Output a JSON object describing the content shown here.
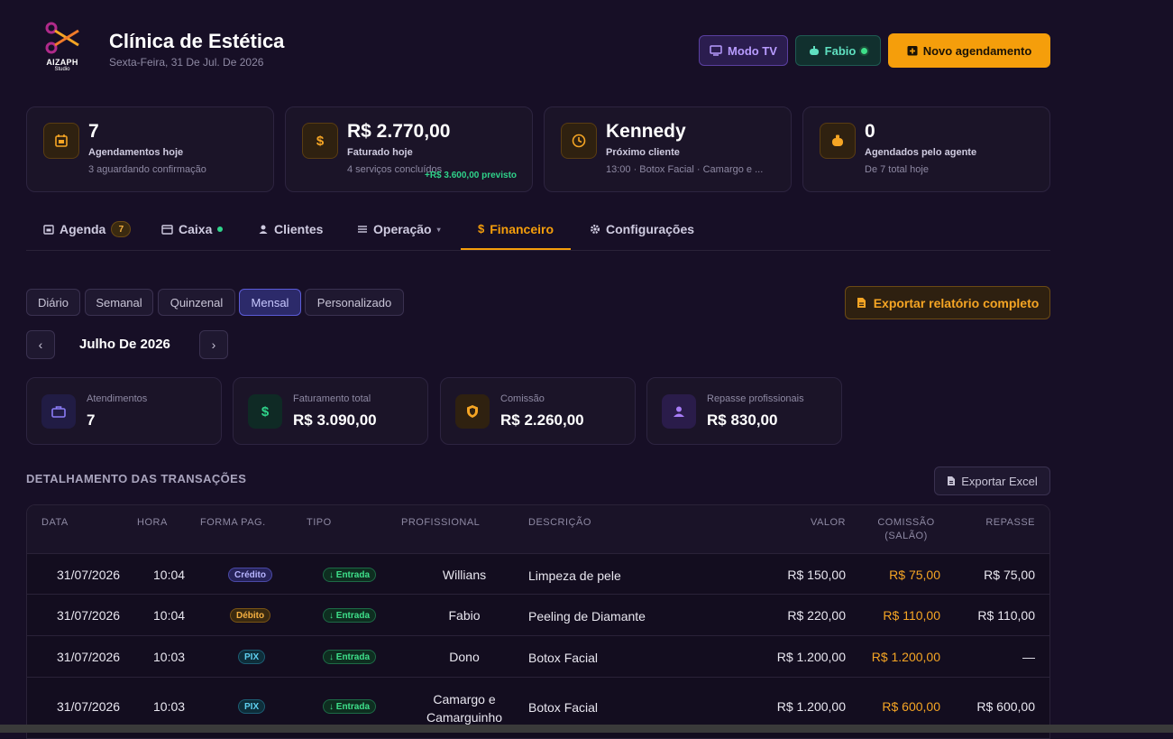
{
  "header": {
    "logo": {
      "brand": "AIZAPH",
      "sub": "Studio"
    },
    "title": "Clínica de Estética",
    "date": "Sexta-Feira, 31 De Jul. De 2026",
    "buttons": {
      "tv": "Modo TV",
      "user": "Fabio",
      "new": "Novo agendamento"
    }
  },
  "stats": [
    {
      "value": "7",
      "label": "Agendamentos hoje",
      "sub": "3 aguardando confirmação",
      "icon": "calendar-icon"
    },
    {
      "value": "R$ 2.770,00",
      "label": "Faturado hoje",
      "sub": "4 serviços concluídos",
      "extra": "+R$ 3.600,00 previsto",
      "icon": "dollar-icon"
    },
    {
      "value": "Kennedy",
      "label": "Próximo cliente",
      "sub": "13:00 · Botox Facial · Camargo e ...",
      "icon": "clock-icon"
    },
    {
      "value": "0",
      "label": "Agendados pelo agente",
      "sub": "De 7 total hoje",
      "icon": "robot-icon"
    }
  ],
  "tabs": [
    {
      "label": "Agenda",
      "badge": "7",
      "icon": "calendar-icon"
    },
    {
      "label": "Caixa",
      "icon": "card-icon"
    },
    {
      "label": "Clientes",
      "icon": "person-icon"
    },
    {
      "label": "Operação",
      "icon": "menu-icon"
    },
    {
      "label": "Financeiro",
      "icon": "dollar-icon",
      "active": true
    },
    {
      "label": "Configurações",
      "icon": "gear-icon"
    }
  ],
  "periods": [
    "Diário",
    "Semanal",
    "Quinzenal",
    "Mensal",
    "Personalizado"
  ],
  "active_period": "Mensal",
  "export_report": "Exportar relatório completo",
  "month": "Julho De 2026",
  "summary": [
    {
      "label": "Atendimentos",
      "value": "7",
      "icon": "briefcase-icon"
    },
    {
      "label": "Faturamento total",
      "value": "R$ 3.090,00",
      "icon": "dollar-icon"
    },
    {
      "label": "Comissão",
      "value": "R$ 2.260,00",
      "icon": "shield-icon"
    },
    {
      "label": "Repasse profissionais",
      "value": "R$ 830,00",
      "icon": "person-icon"
    }
  ],
  "transactions": {
    "title": "DETALHAMENTO DAS TRANSAÇÕES",
    "export_excel": "Exportar Excel",
    "columns": [
      "DATA",
      "HORA",
      "FORMA PAG.",
      "TIPO",
      "PROFISSIONAL",
      "DESCRIÇÃO",
      "VALOR",
      "COMISSÃO (SALÃO)",
      "REPASSE"
    ],
    "rows": [
      {
        "data": "31/07/2026",
        "hora": "10:04",
        "forma": "Crédito",
        "tipo": "↓ Entrada",
        "prof": "Willians",
        "desc": "Limpeza de pele",
        "valor": "R$ 150,00",
        "comissao": "R$ 75,00",
        "repasse": "R$ 75,00"
      },
      {
        "data": "31/07/2026",
        "hora": "10:04",
        "forma": "Débito",
        "tipo": "↓ Entrada",
        "prof": "Fabio",
        "desc": "Peeling de Diamante",
        "valor": "R$ 220,00",
        "comissao": "R$ 110,00",
        "repasse": "R$ 110,00"
      },
      {
        "data": "31/07/2026",
        "hora": "10:03",
        "forma": "PIX",
        "tipo": "↓ Entrada",
        "prof": "Dono",
        "desc": "Botox Facial",
        "valor": "R$ 1.200,00",
        "comissao": "R$ 1.200,00",
        "repasse": "—"
      },
      {
        "data": "31/07/2026",
        "hora": "10:03",
        "forma": "PIX",
        "tipo": "↓ Entrada",
        "prof": "Camargo e Camarguinho",
        "desc": "Botox Facial",
        "valor": "R$ 1.200,00",
        "comissao": "R$ 600,00",
        "repasse": "R$ 600,00"
      }
    ]
  },
  "colors": {
    "accent": "#f59e0b",
    "background": "#170f26",
    "positive": "#2fd38a"
  }
}
